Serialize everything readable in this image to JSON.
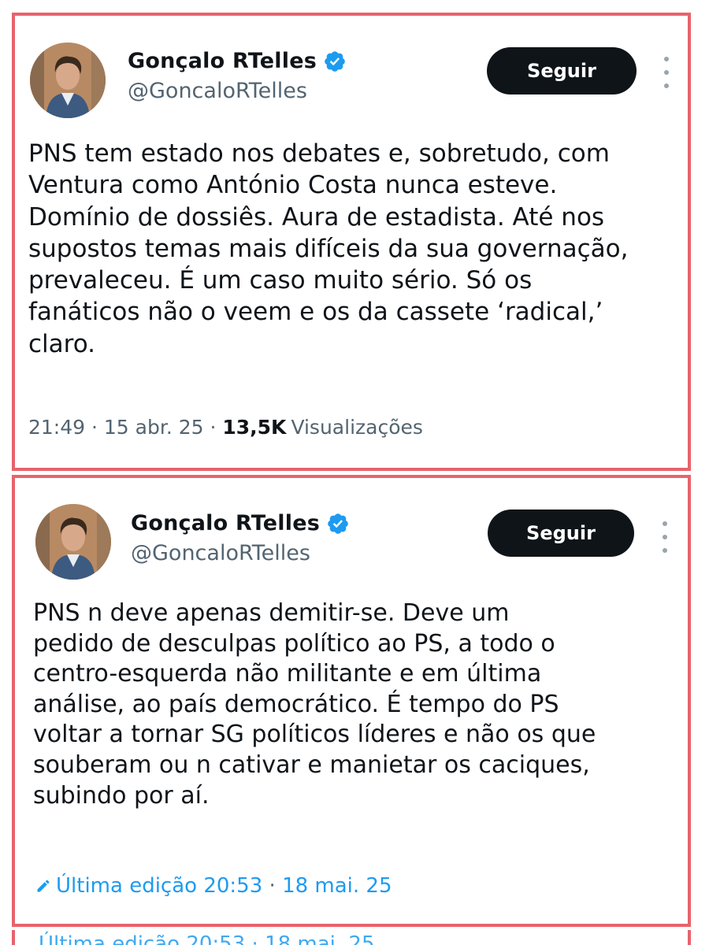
{
  "tweets": [
    {
      "author_name": "Gonçalo RTelles",
      "handle": "@GoncaloRTelles",
      "follow_label": "Seguir",
      "text": "PNS tem estado nos debates e, sobretudo, com\nVentura como António Costa nunca esteve.\nDomínio de dossiês. Aura de estadista. Até nos\nsupostos temas mais difíceis da sua governação,\nprevaleceu. É um caso muito sério. Só os\nfanáticos não o veem e os da cassete ‘radical,’\nclaro.",
      "time": "21:49",
      "date": "15 abr. 25",
      "views_count": "13,5K",
      "views_label": "Visualizações"
    },
    {
      "author_name": "Gonçalo RTelles",
      "handle": "@GoncaloRTelles",
      "follow_label": "Seguir",
      "text": "PNS n deve apenas demitir-se. Deve um\npedido de desculpas político ao PS, a todo o\ncentro-esquerda não militante e em última\nanálise, ao país democrático. É tempo do PS\nvoltar a tornar SG políticos líderes e não os que\nsouberam ou n cativar e manietar os caciques,\nsubindo por aí.",
      "edit_label": "Última edição",
      "time": "20:53",
      "date": "18 mai. 25"
    }
  ],
  "separator": " · ",
  "partial_next": "Última edição 20:53 · 18 mai. 25",
  "colors": {
    "border": "#e8636b",
    "verified": "#1d9bf0",
    "secondary_text": "#536471",
    "button_bg": "#0f1419"
  },
  "icons": {
    "verified": "verified-badge-icon",
    "more": "more-vertical-icon",
    "edit": "pencil-icon"
  }
}
